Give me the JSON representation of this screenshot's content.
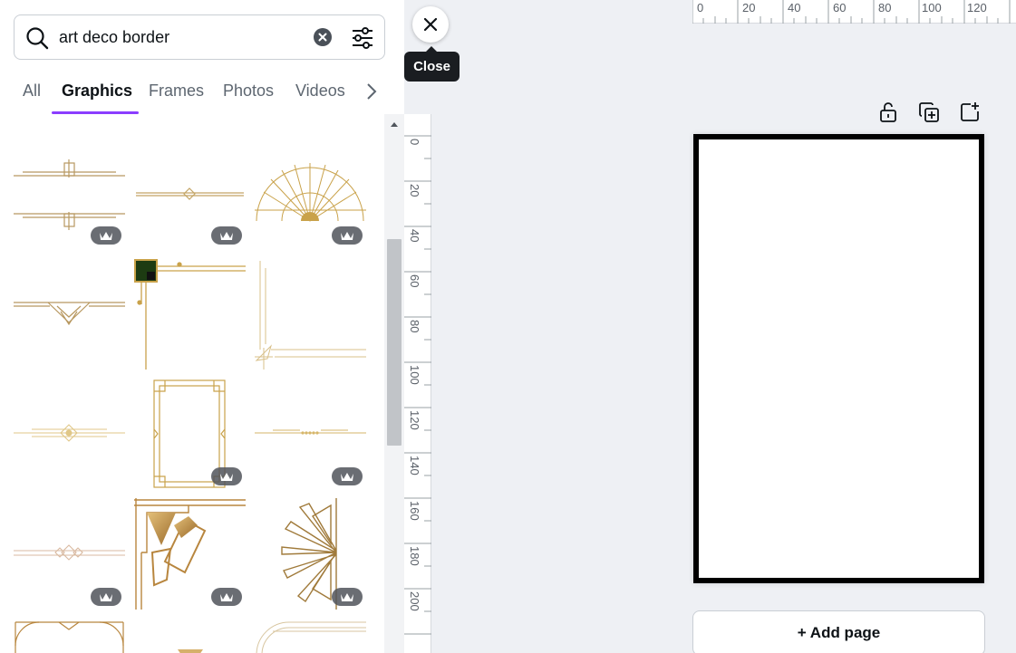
{
  "search": {
    "query": "art deco border"
  },
  "tabs": [
    {
      "label": "All"
    },
    {
      "label": "Graphics"
    },
    {
      "label": "Frames"
    },
    {
      "label": "Photos"
    },
    {
      "label": "Videos"
    }
  ],
  "active_tab": "Graphics",
  "results": {
    "items": [
      {
        "name": "double-line-deco-divider",
        "premium": true
      },
      {
        "name": "thin-diamond-divider",
        "premium": true
      },
      {
        "name": "sunburst-fan-ornament",
        "premium": true
      },
      {
        "name": "chevron-deco-divider",
        "premium": false
      },
      {
        "name": "green-corner-border",
        "premium": false
      },
      {
        "name": "gold-corner-border",
        "premium": false
      },
      {
        "name": "gold-diamond-divider",
        "premium": false
      },
      {
        "name": "gold-rectangle-frame",
        "premium": true
      },
      {
        "name": "dotted-line-divider",
        "premium": true
      },
      {
        "name": "pink-diamond-divider",
        "premium": true
      },
      {
        "name": "gold-fan-corner",
        "premium": true
      },
      {
        "name": "fan-side-ornament",
        "premium": true
      }
    ]
  },
  "close": {
    "tooltip": "Close"
  },
  "ruler": {
    "top": [
      "0",
      "20",
      "40",
      "60",
      "80",
      "100",
      "120"
    ],
    "left": [
      "0",
      "20",
      "40",
      "60",
      "80",
      "100",
      "120",
      "140",
      "160",
      "180",
      "200"
    ]
  },
  "canvas": {
    "add_page_label": "+ Add page"
  },
  "colors": {
    "accent": "#8b3dff",
    "gold": "#c9a24a",
    "canvas_bg": "#eef0f4",
    "page_border": "#000000"
  },
  "icons": {
    "search": "search-icon",
    "clear": "clear-search-icon",
    "filter": "filter-sliders-icon",
    "next": "chevron-right-icon",
    "close": "close-icon",
    "lock": "unlock-icon",
    "duplicate": "duplicate-page-icon",
    "add_page": "add-page-icon",
    "premium": "crown-icon"
  }
}
